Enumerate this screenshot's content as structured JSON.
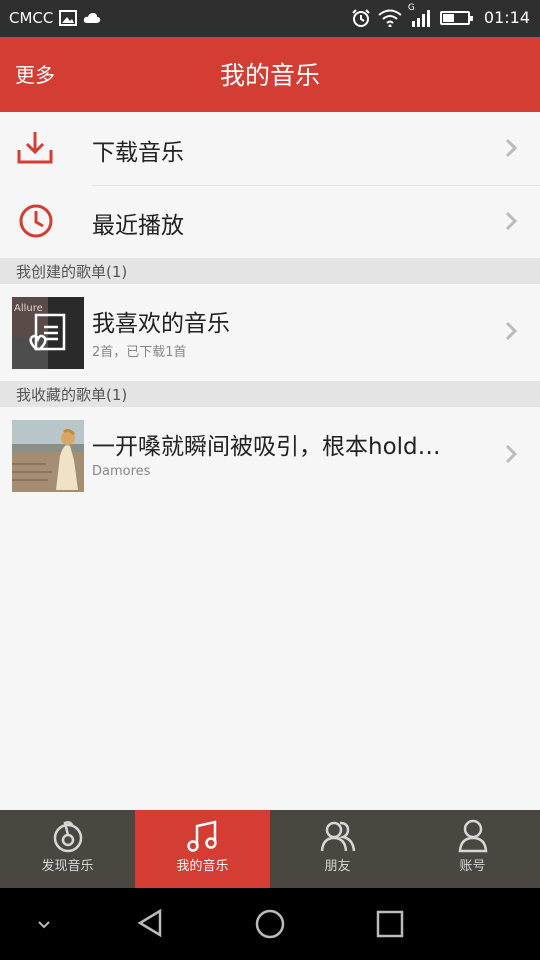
{
  "status_bar": {
    "carrier": "CMCC",
    "time": "01:14",
    "network": "G",
    "battery_level": 0.45,
    "icons": [
      "image-icon",
      "cloud-icon",
      "alarm-icon",
      "wifi-icon",
      "signal-icon",
      "battery-icon"
    ]
  },
  "header": {
    "more_label": "更多",
    "title": "我的音乐"
  },
  "menu": {
    "items": [
      {
        "label": "下载音乐",
        "icon": "download-icon"
      },
      {
        "label": "最近播放",
        "icon": "clock-icon"
      }
    ]
  },
  "created_section": {
    "title": "我创建的歌单(1)",
    "playlists": [
      {
        "name": "我喜欢的音乐",
        "subtitle": "2首，已下载1首",
        "cover_text": "Allure"
      }
    ]
  },
  "collected_section": {
    "title": "我收藏的歌单(1)",
    "playlists": [
      {
        "name": "一开嗓就瞬间被吸引，根本hold…",
        "subtitle": "Damores"
      }
    ]
  },
  "tab_bar": {
    "tabs": [
      {
        "label": "发现音乐",
        "icon": "discover-icon",
        "active": false
      },
      {
        "label": "我的音乐",
        "icon": "music-note-icon",
        "active": true
      },
      {
        "label": "朋友",
        "icon": "friends-icon",
        "active": false
      },
      {
        "label": "账号",
        "icon": "account-icon",
        "active": false
      }
    ]
  },
  "colors": {
    "accent": "#d43d33",
    "tab_bar_bg": "#4a4640",
    "status_bar_bg": "#2f2f2f",
    "section_bg": "#e4e4e4"
  }
}
